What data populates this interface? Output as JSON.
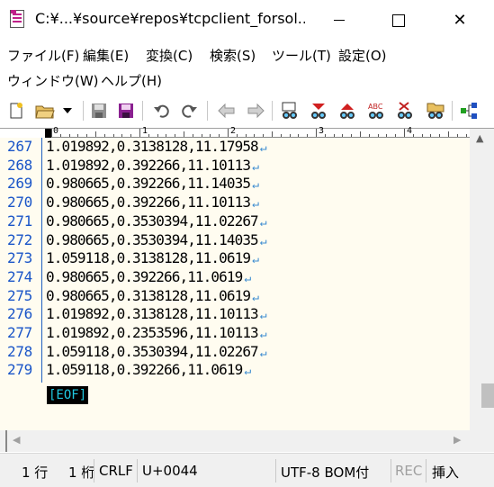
{
  "window": {
    "title": "C:¥...¥source¥repos¥tcpclient_forsol...",
    "min_label": "",
    "close_label": "✕"
  },
  "menu": {
    "items": [
      "ファイル(F)",
      "編集(E)",
      "変換(C)",
      "検索(S)",
      "ツール(T)",
      "設定(O)",
      "ウィンドウ(W)",
      "ヘルプ(H)"
    ]
  },
  "toolbar": {
    "icons": [
      "new-file-icon",
      "open-folder-icon",
      "dropdown-arrow-icon",
      "save-icon",
      "save-all-icon",
      "undo-icon",
      "redo-icon",
      "jump-back-icon",
      "jump-forward-icon",
      "search-icon",
      "search-next-icon",
      "search-prev-icon",
      "mark-icon",
      "clear-mark-icon",
      "grep-icon",
      "outline-icon"
    ]
  },
  "ruler": {
    "labels": [
      "0",
      "1",
      "2",
      "3",
      "4"
    ]
  },
  "editor": {
    "lines": [
      {
        "num": "267",
        "text": "1.019892,0.3138128,11.17958"
      },
      {
        "num": "268",
        "text": "1.019892,0.392266,11.10113"
      },
      {
        "num": "269",
        "text": "0.980665,0.392266,11.14035"
      },
      {
        "num": "270",
        "text": "0.980665,0.392266,11.10113"
      },
      {
        "num": "271",
        "text": "0.980665,0.3530394,11.02267"
      },
      {
        "num": "272",
        "text": "0.980665,0.3530394,11.14035"
      },
      {
        "num": "273",
        "text": "1.059118,0.3138128,11.0619"
      },
      {
        "num": "274",
        "text": "0.980665,0.392266,11.0619"
      },
      {
        "num": "275",
        "text": "0.980665,0.3138128,11.0619"
      },
      {
        "num": "276",
        "text": "1.019892,0.3138128,11.10113"
      },
      {
        "num": "277",
        "text": "1.019892,0.2353596,11.10113"
      },
      {
        "num": "278",
        "text": "1.059118,0.3530394,11.02267"
      },
      {
        "num": "279",
        "text": "1.059118,0.392266,11.0619"
      }
    ],
    "eol_mark": "↵",
    "eof_mark": "[EOF]"
  },
  "status": {
    "line": "1 行",
    "column": "1 桁",
    "newline": "CRLF",
    "codepoint": "U+0044",
    "encoding": "UTF-8 BOM付",
    "rec": "REC",
    "mode": "挿入"
  },
  "colors": {
    "editor_bg": "#fffcf0",
    "line_number": "#1a55c8",
    "eof_fg": "#20c8e0",
    "eol_mark": "#3b8bd0"
  }
}
